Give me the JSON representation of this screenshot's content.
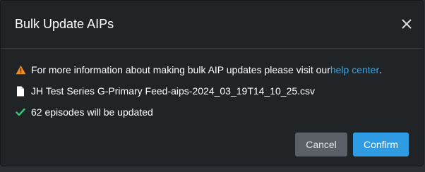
{
  "modal": {
    "title": "Bulk Update AIPs",
    "close_label": "×"
  },
  "body": {
    "info_text": "For more information about making bulk AIP updates please visit our ",
    "info_link": "help center",
    "info_suffix": ".",
    "file_name": "JH Test Series G-Primary Feed-aips-2024_03_19T14_10_25.csv",
    "status_text": "62 episodes will be updated"
  },
  "footer": {
    "cancel_label": "Cancel",
    "confirm_label": "Confirm"
  },
  "colors": {
    "warning": "#f08a24",
    "success": "#2ecc71",
    "link": "#3aa3e3",
    "confirm": "#2f9be2",
    "cancel": "#5b6066"
  },
  "icons": {
    "warning": "warning-triangle-icon",
    "file": "file-icon",
    "check": "check-icon",
    "close": "close-icon"
  }
}
